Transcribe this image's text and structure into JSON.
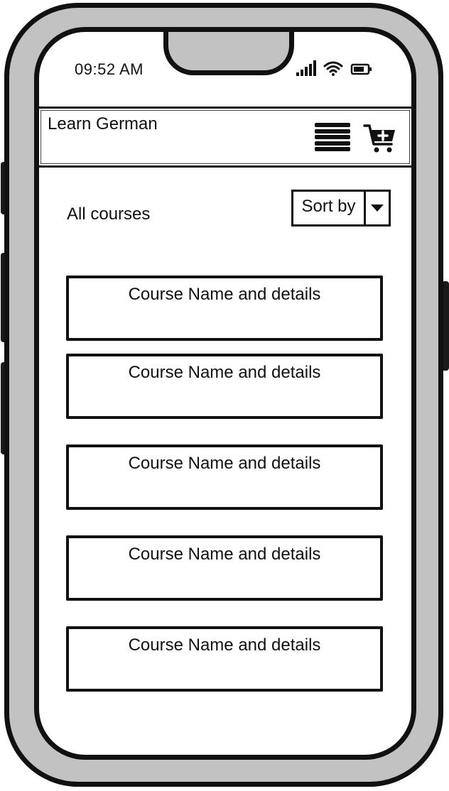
{
  "status_bar": {
    "time": "09:52 AM",
    "icons": [
      "cellular-signal-icon",
      "wifi-icon",
      "battery-icon"
    ]
  },
  "header": {
    "title": "Learn German",
    "icons": [
      "hamburger-menu-icon",
      "add-to-cart-icon"
    ]
  },
  "toolbar": {
    "heading": "All courses",
    "sort": {
      "selected": "Sort by",
      "icon": "chevron-down-icon"
    }
  },
  "courses": [
    {
      "label": "Course Name and details"
    },
    {
      "label": "Course Name and details"
    },
    {
      "label": "Course Name and details"
    },
    {
      "label": "Course Name and details"
    },
    {
      "label": "Course Name and details"
    }
  ],
  "colors": {
    "ink": "#111111",
    "frame": "#c2c2c2",
    "screen": "#ffffff"
  }
}
